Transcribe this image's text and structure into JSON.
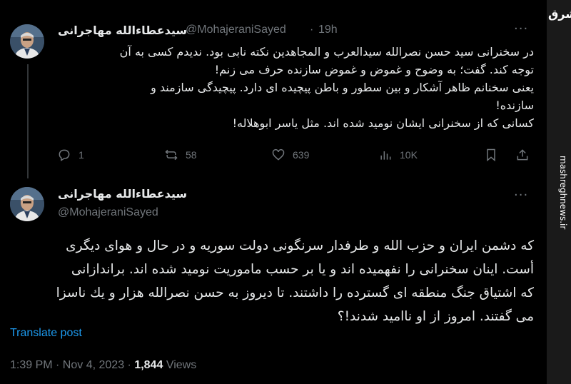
{
  "watermark": {
    "logo": "مشرق",
    "url": "mashreghnews.ir"
  },
  "tweet1": {
    "display_name": "سیدعطاءالله مهاجرانی",
    "handle": "@MohajeraniSayed",
    "separator": "·",
    "time": "19h",
    "lines": [
      "در سخنرانی سید حسن نصرالله سیدالعرب و المجاهدین نکته نابی بود. ندیدم کسی به آن",
      "توجه کند. گفت؛  به وضوح و غموض و غموض سازنده حرف می زنم!",
      "یعنی سخنانم ظاهر آشکار و بین سطور و باطن پیچیده ای دارد.  پیچیدگی سازمند و",
      "سازنده!",
      "کسانی که از سخنرانی ایشان نومید شده اند. مثل یاسر ابوهلاله!"
    ],
    "actions": {
      "replies": "1",
      "reposts": "58",
      "likes": "639",
      "views": "10K"
    }
  },
  "tweet2": {
    "display_name": "سیدعطاءالله مهاجرانی",
    "handle": "@MohajeraniSayed",
    "lines": [
      "که دشمن ایران و حزب الله و طرفدار سرنگونی دولت سوریه و در حال و هوای دیگری",
      "أست.  اینان سخنرانی را نفهمیده اند و یا بر حسب ماموریت نومید شده اند.  براندازانی",
      "که اشتیاق جنگ منطقه ای گسترده را داشتند. تا دیروز به حسن نصرالله هزار و یك ناسزا",
      "می گفتند. امروز  از او ناامید شدند!؟"
    ],
    "translate_label": "Translate post",
    "timestamp": "1:39 PM · Nov 4, 2023 ·",
    "views_count": "1,844",
    "views_label": "Views"
  }
}
